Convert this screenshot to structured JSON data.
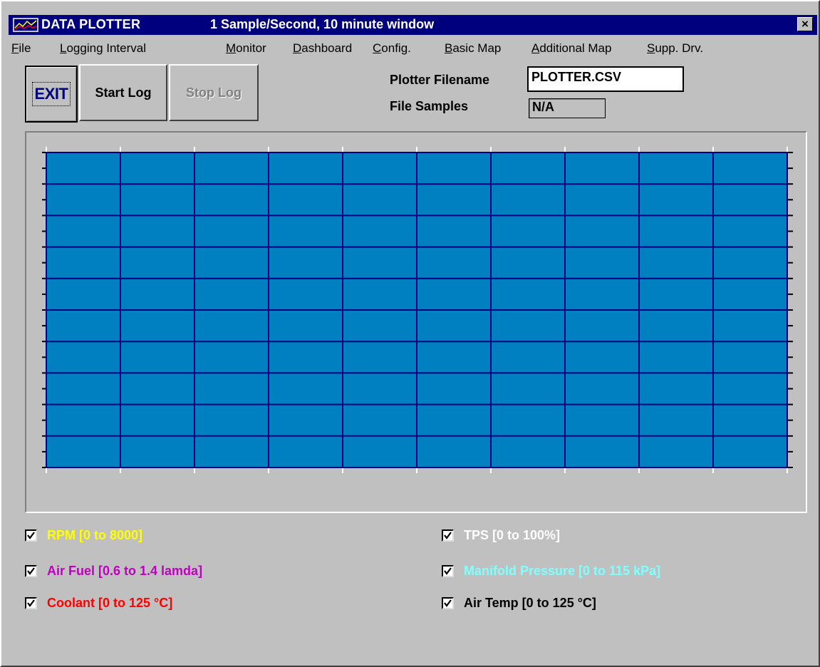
{
  "window": {
    "title": "DATA PLOTTER",
    "subtitle": "1 Sample/Second,  10 minute window",
    "close_glyph": "×"
  },
  "menu": [
    {
      "label": "File",
      "underline": "F",
      "rest": "ile"
    },
    {
      "label": "Logging Interval",
      "underline": "L",
      "rest": "ogging Interval"
    },
    {
      "label": "Monitor",
      "underline": "M",
      "rest": "onitor"
    },
    {
      "label": "Dashboard",
      "underline": "D",
      "rest": "ashboard"
    },
    {
      "label": "Config.",
      "underline": "C",
      "rest": "onfig."
    },
    {
      "label": "Basic Map",
      "underline": "B",
      "rest": "asic Map"
    },
    {
      "label": "Additional Map",
      "underline": "A",
      "rest": "dditional Map"
    },
    {
      "label": "Supp. Drv.",
      "underline": "S",
      "rest": "upp. Drv."
    }
  ],
  "toolbar": {
    "exit_label": "EXIT",
    "start_label": "Start Log",
    "stop_label": "Stop Log",
    "stop_enabled": false
  },
  "file": {
    "filename_label": "Plotter Filename",
    "filename_value": "PLOTTER.CSV",
    "samples_label": "File Samples",
    "samples_value": "N/A"
  },
  "plot": {
    "background_color": "#0080c0",
    "grid_color": "#000080",
    "vertical_divisions": 10,
    "horizontal_divisions": 10
  },
  "legend": [
    {
      "label": "RPM [0 to 8000]",
      "color": "#ffff00",
      "checked": true
    },
    {
      "label": "TPS [0 to 100%]",
      "color": "#ffffff",
      "checked": true
    },
    {
      "label": "Air Fuel [0.6 to 1.4 lamda]",
      "color": "#c000c0",
      "checked": true
    },
    {
      "label": "Manifold Pressure [0 to 115 kPa]",
      "color": "#80ffff",
      "checked": true
    },
    {
      "label": "Coolant [0 to 125 °C]",
      "color": "#ff0000",
      "checked": true
    },
    {
      "label": "Air Temp [0 to 125 °C]",
      "color": "#000000",
      "checked": true
    }
  ]
}
